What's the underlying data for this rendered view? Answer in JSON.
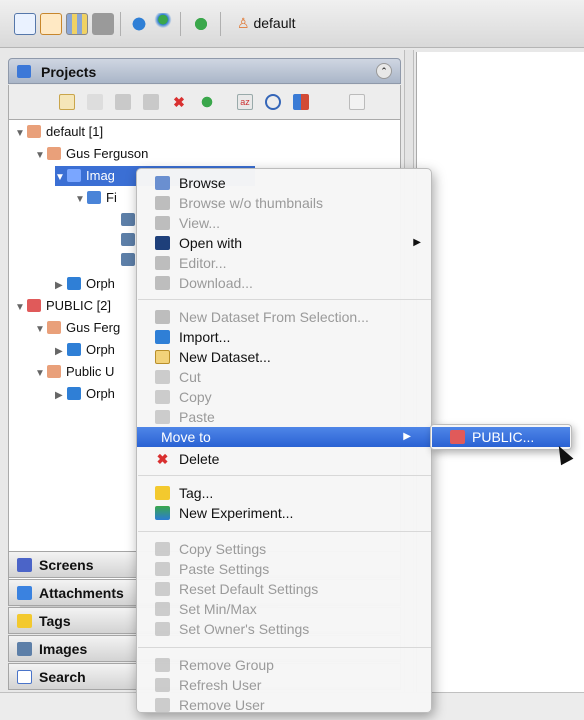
{
  "toolbar": {
    "user_label": "default",
    "colors": {
      "accent": "#2a62d3"
    }
  },
  "projects_panel": {
    "title": "Projects",
    "tree": [
      {
        "label": "default [1]"
      },
      {
        "label": "Gus Ferguson"
      },
      {
        "label": "Imag"
      },
      {
        "label": "Fi"
      },
      {
        "label": "Orph"
      },
      {
        "label": "PUBLIC [2]"
      },
      {
        "label": "Gus Ferg"
      },
      {
        "label": "Orph"
      },
      {
        "label": "Public U"
      },
      {
        "label": "Orph"
      }
    ]
  },
  "accordion": [
    {
      "label": "Screens",
      "icon": "screens-icon"
    },
    {
      "label": "Attachments",
      "icon": "attachments-icon"
    },
    {
      "label": "Tags",
      "icon": "tags-icon"
    },
    {
      "label": "Images",
      "icon": "images-icon"
    },
    {
      "label": "Search",
      "icon": "search-icon"
    }
  ],
  "context_menu": {
    "items": [
      {
        "label": "Browse",
        "icon": "browse-icon",
        "disabled": false
      },
      {
        "label": "Browse w/o thumbnails",
        "icon": "browse-icon",
        "disabled": true
      },
      {
        "label": "View...",
        "icon": "view-icon",
        "disabled": true
      },
      {
        "label": "Open with",
        "icon": "open-with-icon",
        "disabled": false,
        "submenu": true
      },
      {
        "label": "Editor...",
        "icon": "editor-icon",
        "disabled": true
      },
      {
        "label": "Download...",
        "icon": "download-icon",
        "disabled": true
      },
      {
        "label": "New Dataset From Selection...",
        "icon": "dataset-icon",
        "disabled": true
      },
      {
        "label": "Import...",
        "icon": "import-icon",
        "disabled": false
      },
      {
        "label": "New Dataset...",
        "icon": "new-dataset-icon",
        "disabled": false
      },
      {
        "label": "Cut",
        "icon": "cut-icon",
        "disabled": true
      },
      {
        "label": "Copy",
        "icon": "copy-icon",
        "disabled": true
      },
      {
        "label": "Paste",
        "icon": "paste-icon",
        "disabled": true
      },
      {
        "label": "Move to",
        "icon": "",
        "disabled": false,
        "submenu": true,
        "highlighted": true
      },
      {
        "label": "Delete",
        "icon": "delete-icon",
        "disabled": false
      },
      {
        "label": "Tag...",
        "icon": "tag-icon",
        "disabled": false
      },
      {
        "label": "New Experiment...",
        "icon": "experiment-icon",
        "disabled": false
      },
      {
        "label": "Copy Settings",
        "icon": "copy-settings-icon",
        "disabled": true
      },
      {
        "label": "Paste Settings",
        "icon": "paste-settings-icon",
        "disabled": true
      },
      {
        "label": "Reset Default Settings",
        "icon": "reset-icon",
        "disabled": true
      },
      {
        "label": "Set Min/Max",
        "icon": "minmax-icon",
        "disabled": true
      },
      {
        "label": "Set Owner's Settings",
        "icon": "owner-settings-icon",
        "disabled": true
      },
      {
        "label": "Remove Group",
        "icon": "remove-group-icon",
        "disabled": true
      },
      {
        "label": "Refresh User",
        "icon": "refresh-icon",
        "disabled": true
      },
      {
        "label": "Remove User",
        "icon": "remove-user-icon",
        "disabled": true
      }
    ],
    "submenu_item": "PUBLIC..."
  }
}
